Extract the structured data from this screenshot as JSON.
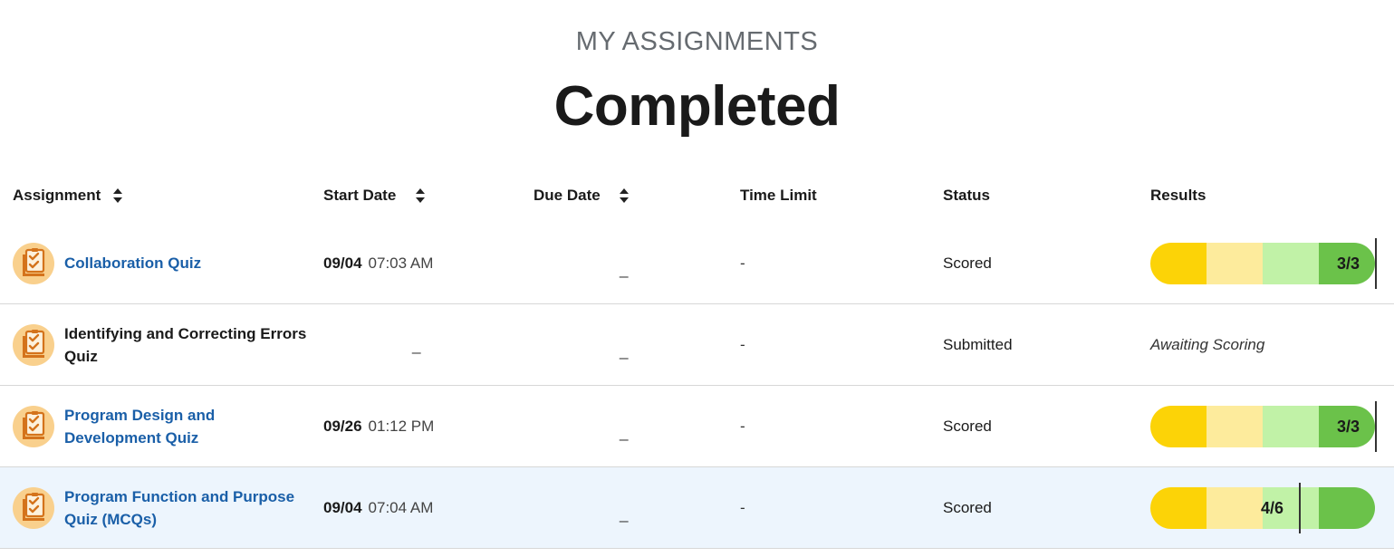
{
  "page": {
    "subtitle": "MY ASSIGNMENTS",
    "title": "Completed"
  },
  "columns": {
    "assignment": "Assignment",
    "start_date": "Start Date",
    "due_date": "Due Date",
    "time_limit": "Time Limit",
    "status": "Status",
    "results": "Results"
  },
  "colors": {
    "link": "#1a5fa8",
    "icon_bg": "#f9d08d",
    "icon_fg": "#d4731b",
    "bar_seg1": "#fcd307",
    "bar_seg2": "#fdeb9c",
    "bar_seg3": "#c1f2a7",
    "bar_seg4": "#6bc24a",
    "row_highlight": "#edf5fd"
  },
  "rows": [
    {
      "icon": "quiz-checklist-icon",
      "name_line1": "Collaboration Quiz",
      "name_line2": "",
      "is_link": true,
      "start_date": "09/04",
      "start_time": "07:03 AM",
      "start_empty": "",
      "due": "_",
      "time_limit": "-",
      "status": "Scored",
      "result": {
        "score": "3/3",
        "fraction": 1.0,
        "awaiting_text": ""
      }
    },
    {
      "icon": "quiz-checklist-icon",
      "name_line1": "Identifying and Correcting Errors",
      "name_line2": "Quiz",
      "is_link": false,
      "start_date": "",
      "start_time": "",
      "start_empty": "_",
      "due": "_",
      "time_limit": "-",
      "status": "Submitted",
      "result": {
        "score": "",
        "fraction": null,
        "awaiting_text": "Awaiting Scoring"
      }
    },
    {
      "icon": "quiz-checklist-icon",
      "name_line1": "Program Design and",
      "name_line2": "Development Quiz",
      "is_link": true,
      "start_date": "09/26",
      "start_time": "01:12 PM",
      "start_empty": "",
      "due": "_",
      "time_limit": "-",
      "status": "Scored",
      "result": {
        "score": "3/3",
        "fraction": 1.0,
        "awaiting_text": ""
      }
    },
    {
      "icon": "quiz-checklist-icon",
      "name_line1": "Program Function and Purpose",
      "name_line2": "Quiz (MCQs)",
      "is_link": true,
      "start_date": "09/04",
      "start_time": "07:04 AM",
      "start_empty": "",
      "due": "_",
      "time_limit": "-",
      "status": "Scored",
      "result": {
        "score": "4/6",
        "fraction": 0.6667,
        "awaiting_text": ""
      }
    }
  ]
}
